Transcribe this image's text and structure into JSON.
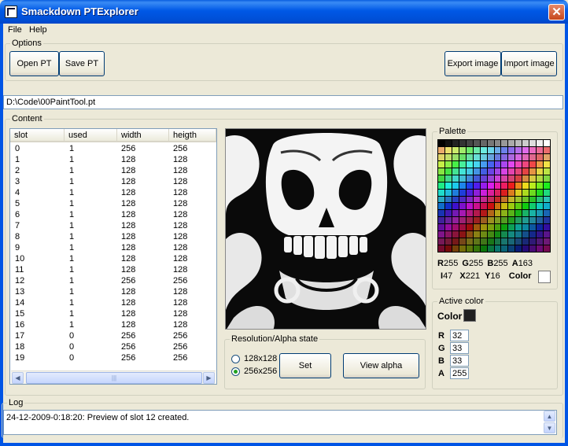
{
  "window": {
    "title": "Smackdown PTExplorer",
    "close_glyph": "✕"
  },
  "menu": [
    {
      "label": "File"
    },
    {
      "label": "Help"
    }
  ],
  "options": {
    "group_label": "Options",
    "open_pt": "Open PT",
    "save_pt": "Save PT",
    "export_image": "Export image",
    "import_image": "Import image"
  },
  "file_path": "D:\\Code\\00PaintTool.pt",
  "content": {
    "group_label": "Content",
    "columns": [
      "slot",
      "used",
      "width",
      "heigth"
    ],
    "rows": [
      [
        "0",
        "1",
        "256",
        "256"
      ],
      [
        "1",
        "1",
        "128",
        "128"
      ],
      [
        "2",
        "1",
        "128",
        "128"
      ],
      [
        "3",
        "1",
        "128",
        "128"
      ],
      [
        "4",
        "1",
        "128",
        "128"
      ],
      [
        "5",
        "1",
        "128",
        "128"
      ],
      [
        "6",
        "1",
        "128",
        "128"
      ],
      [
        "7",
        "1",
        "128",
        "128"
      ],
      [
        "8",
        "1",
        "128",
        "128"
      ],
      [
        "9",
        "1",
        "128",
        "128"
      ],
      [
        "10",
        "1",
        "128",
        "128"
      ],
      [
        "11",
        "1",
        "128",
        "128"
      ],
      [
        "12",
        "1",
        "256",
        "256"
      ],
      [
        "13",
        "1",
        "128",
        "128"
      ],
      [
        "14",
        "1",
        "128",
        "128"
      ],
      [
        "15",
        "1",
        "128",
        "128"
      ],
      [
        "16",
        "1",
        "128",
        "128"
      ],
      [
        "17",
        "0",
        "256",
        "256"
      ],
      [
        "18",
        "0",
        "256",
        "256"
      ],
      [
        "19",
        "0",
        "256",
        "256"
      ]
    ]
  },
  "resolution": {
    "group_label": "Resolution/Alpha state",
    "option_128": "128x128",
    "option_256": "256x256",
    "selected": "256x256",
    "set_label": "Set",
    "view_alpha_label": "View alpha"
  },
  "palette": {
    "group_label": "Palette",
    "r_label": "R",
    "r_value": "255",
    "g_label": "G",
    "g_value": "255",
    "b_label": "B",
    "b_value": "255",
    "a_label": "A",
    "a_value": "163",
    "i_label": "I",
    "i_value": "47",
    "x_label": "X",
    "x_value": "221",
    "y_label": "Y",
    "y_value": "16",
    "color_label": "Color",
    "hover_color": "#ffffff"
  },
  "active_color": {
    "group_label": "Active color",
    "color_label": "Color",
    "swatch": "#202020",
    "r_label": "R",
    "r_value": "32",
    "g_label": "G",
    "g_value": "33",
    "b_label": "B",
    "b_value": "33",
    "a_label": "A",
    "a_value": "255"
  },
  "log": {
    "group_label": "Log",
    "text": "24-12-2009-0:18:20: Preview of slot 12 created."
  },
  "colors": {
    "title_bar": "#0055e5",
    "window_bg": "#ece9d8",
    "input_border": "#7f9db9"
  }
}
